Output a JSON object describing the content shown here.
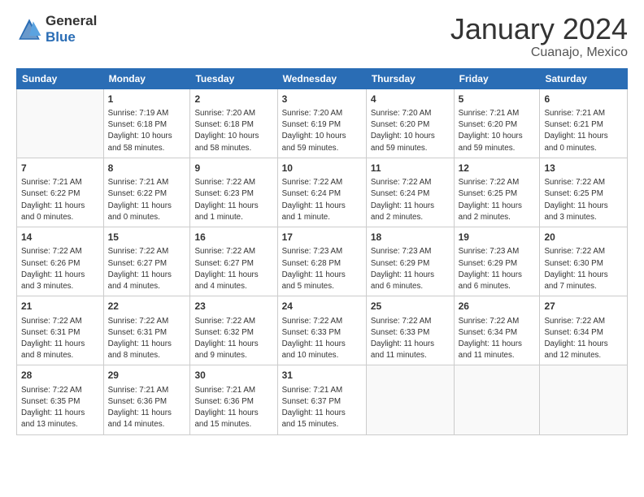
{
  "header": {
    "logo_general": "General",
    "logo_blue": "Blue",
    "month_title": "January 2024",
    "location": "Cuanajo, Mexico"
  },
  "weekdays": [
    "Sunday",
    "Monday",
    "Tuesday",
    "Wednesday",
    "Thursday",
    "Friday",
    "Saturday"
  ],
  "weeks": [
    [
      {
        "day": "",
        "info": ""
      },
      {
        "day": "1",
        "info": "Sunrise: 7:19 AM\nSunset: 6:18 PM\nDaylight: 10 hours\nand 58 minutes."
      },
      {
        "day": "2",
        "info": "Sunrise: 7:20 AM\nSunset: 6:18 PM\nDaylight: 10 hours\nand 58 minutes."
      },
      {
        "day": "3",
        "info": "Sunrise: 7:20 AM\nSunset: 6:19 PM\nDaylight: 10 hours\nand 59 minutes."
      },
      {
        "day": "4",
        "info": "Sunrise: 7:20 AM\nSunset: 6:20 PM\nDaylight: 10 hours\nand 59 minutes."
      },
      {
        "day": "5",
        "info": "Sunrise: 7:21 AM\nSunset: 6:20 PM\nDaylight: 10 hours\nand 59 minutes."
      },
      {
        "day": "6",
        "info": "Sunrise: 7:21 AM\nSunset: 6:21 PM\nDaylight: 11 hours\nand 0 minutes."
      }
    ],
    [
      {
        "day": "7",
        "info": "Sunrise: 7:21 AM\nSunset: 6:22 PM\nDaylight: 11 hours\nand 0 minutes."
      },
      {
        "day": "8",
        "info": "Sunrise: 7:21 AM\nSunset: 6:22 PM\nDaylight: 11 hours\nand 0 minutes."
      },
      {
        "day": "9",
        "info": "Sunrise: 7:22 AM\nSunset: 6:23 PM\nDaylight: 11 hours\nand 1 minute."
      },
      {
        "day": "10",
        "info": "Sunrise: 7:22 AM\nSunset: 6:24 PM\nDaylight: 11 hours\nand 1 minute."
      },
      {
        "day": "11",
        "info": "Sunrise: 7:22 AM\nSunset: 6:24 PM\nDaylight: 11 hours\nand 2 minutes."
      },
      {
        "day": "12",
        "info": "Sunrise: 7:22 AM\nSunset: 6:25 PM\nDaylight: 11 hours\nand 2 minutes."
      },
      {
        "day": "13",
        "info": "Sunrise: 7:22 AM\nSunset: 6:25 PM\nDaylight: 11 hours\nand 3 minutes."
      }
    ],
    [
      {
        "day": "14",
        "info": "Sunrise: 7:22 AM\nSunset: 6:26 PM\nDaylight: 11 hours\nand 3 minutes."
      },
      {
        "day": "15",
        "info": "Sunrise: 7:22 AM\nSunset: 6:27 PM\nDaylight: 11 hours\nand 4 minutes."
      },
      {
        "day": "16",
        "info": "Sunrise: 7:22 AM\nSunset: 6:27 PM\nDaylight: 11 hours\nand 4 minutes."
      },
      {
        "day": "17",
        "info": "Sunrise: 7:23 AM\nSunset: 6:28 PM\nDaylight: 11 hours\nand 5 minutes."
      },
      {
        "day": "18",
        "info": "Sunrise: 7:23 AM\nSunset: 6:29 PM\nDaylight: 11 hours\nand 6 minutes."
      },
      {
        "day": "19",
        "info": "Sunrise: 7:23 AM\nSunset: 6:29 PM\nDaylight: 11 hours\nand 6 minutes."
      },
      {
        "day": "20",
        "info": "Sunrise: 7:22 AM\nSunset: 6:30 PM\nDaylight: 11 hours\nand 7 minutes."
      }
    ],
    [
      {
        "day": "21",
        "info": "Sunrise: 7:22 AM\nSunset: 6:31 PM\nDaylight: 11 hours\nand 8 minutes."
      },
      {
        "day": "22",
        "info": "Sunrise: 7:22 AM\nSunset: 6:31 PM\nDaylight: 11 hours\nand 8 minutes."
      },
      {
        "day": "23",
        "info": "Sunrise: 7:22 AM\nSunset: 6:32 PM\nDaylight: 11 hours\nand 9 minutes."
      },
      {
        "day": "24",
        "info": "Sunrise: 7:22 AM\nSunset: 6:33 PM\nDaylight: 11 hours\nand 10 minutes."
      },
      {
        "day": "25",
        "info": "Sunrise: 7:22 AM\nSunset: 6:33 PM\nDaylight: 11 hours\nand 11 minutes."
      },
      {
        "day": "26",
        "info": "Sunrise: 7:22 AM\nSunset: 6:34 PM\nDaylight: 11 hours\nand 11 minutes."
      },
      {
        "day": "27",
        "info": "Sunrise: 7:22 AM\nSunset: 6:34 PM\nDaylight: 11 hours\nand 12 minutes."
      }
    ],
    [
      {
        "day": "28",
        "info": "Sunrise: 7:22 AM\nSunset: 6:35 PM\nDaylight: 11 hours\nand 13 minutes."
      },
      {
        "day": "29",
        "info": "Sunrise: 7:21 AM\nSunset: 6:36 PM\nDaylight: 11 hours\nand 14 minutes."
      },
      {
        "day": "30",
        "info": "Sunrise: 7:21 AM\nSunset: 6:36 PM\nDaylight: 11 hours\nand 15 minutes."
      },
      {
        "day": "31",
        "info": "Sunrise: 7:21 AM\nSunset: 6:37 PM\nDaylight: 11 hours\nand 15 minutes."
      },
      {
        "day": "",
        "info": ""
      },
      {
        "day": "",
        "info": ""
      },
      {
        "day": "",
        "info": ""
      }
    ]
  ]
}
